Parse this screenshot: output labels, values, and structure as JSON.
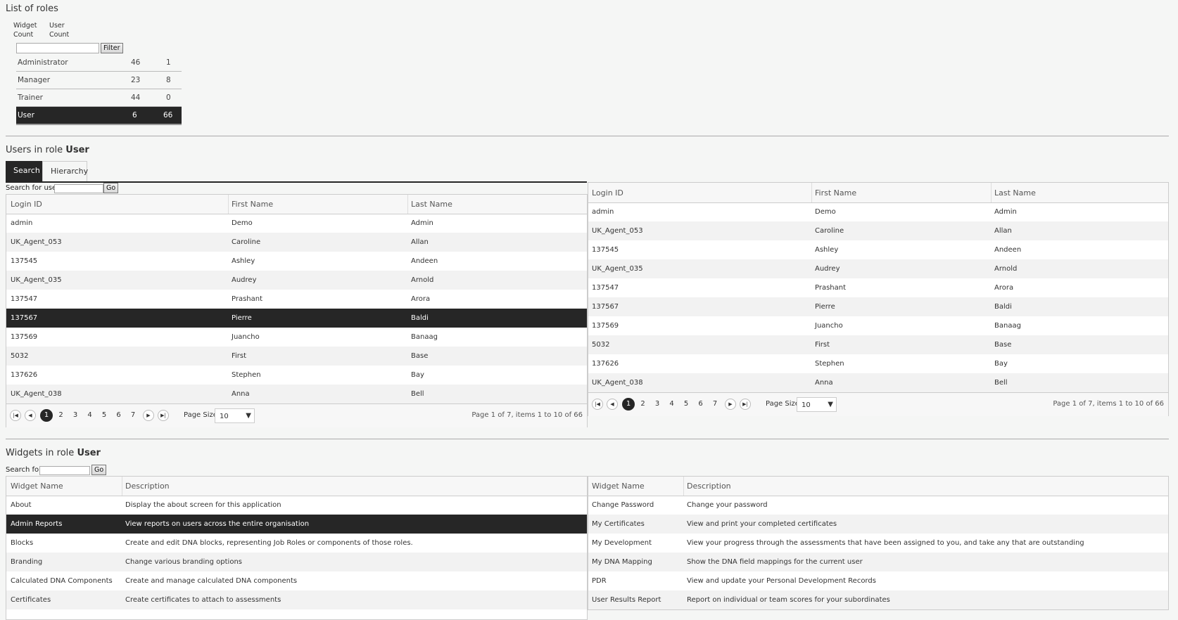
{
  "roles_section": {
    "title": "List of roles",
    "col_widget": [
      "Widget",
      "Count"
    ],
    "col_user": [
      "User",
      "Count"
    ],
    "filter_button": "Filter",
    "filter_value": "",
    "rows": [
      {
        "name": "Administrator",
        "widgets": "46",
        "users": "1"
      },
      {
        "name": "Manager",
        "widgets": "23",
        "users": "8"
      },
      {
        "name": "Trainer",
        "widgets": "44",
        "users": "0"
      },
      {
        "name": "User",
        "widgets": "6",
        "users": "66",
        "selected": true
      }
    ]
  },
  "users_section": {
    "title_prefix": "Users in role ",
    "role": "User",
    "tabs": [
      "Search",
      "Hierarchy"
    ],
    "search_label": "Search for user:",
    "go_button": "Go",
    "columns": [
      "Login ID",
      "First Name",
      "Last Name"
    ],
    "left_rows": [
      [
        "admin",
        "Demo",
        "Admin"
      ],
      [
        "UK_Agent_053",
        "Caroline",
        "Allan"
      ],
      [
        "137545",
        "Ashley",
        "Andeen"
      ],
      [
        "UK_Agent_035",
        "Audrey",
        "Arnold"
      ],
      [
        "137547",
        "Prashant",
        "Arora"
      ],
      [
        "137567",
        "Pierre",
        "Baldi"
      ],
      [
        "137569",
        "Juancho",
        "Banaag"
      ],
      [
        "5032",
        "First",
        "Base"
      ],
      [
        "137626",
        "Stephen",
        "Bay"
      ],
      [
        "UK_Agent_038",
        "Anna",
        "Bell"
      ]
    ],
    "left_selected_index": 5,
    "right_rows": [
      [
        "admin",
        "Demo",
        "Admin"
      ],
      [
        "UK_Agent_053",
        "Caroline",
        "Allan"
      ],
      [
        "137545",
        "Ashley",
        "Andeen"
      ],
      [
        "UK_Agent_035",
        "Audrey",
        "Arnold"
      ],
      [
        "137547",
        "Prashant",
        "Arora"
      ],
      [
        "137567",
        "Pierre",
        "Baldi"
      ],
      [
        "137569",
        "Juancho",
        "Banaag"
      ],
      [
        "5032",
        "First",
        "Base"
      ],
      [
        "137626",
        "Stephen",
        "Bay"
      ],
      [
        "UK_Agent_038",
        "Anna",
        "Bell"
      ]
    ],
    "pager": {
      "pages": [
        "1",
        "2",
        "3",
        "4",
        "5",
        "6",
        "7"
      ],
      "current": "1",
      "page_size_label": "Page Size",
      "page_size": "10",
      "info": "Page 1 of 7, items 1 to 10 of 66"
    }
  },
  "widgets_section": {
    "title_prefix": "Widgets in role ",
    "role": "User",
    "search_label": "Search for:",
    "go_button": "Go",
    "columns": [
      "Widget Name",
      "Description"
    ],
    "left_rows": [
      [
        "About",
        "Display the about screen for this application"
      ],
      [
        "Admin Reports",
        "View reports on users across the entire organisation"
      ],
      [
        "Blocks",
        "Create and edit DNA blocks, representing Job Roles or components of those roles."
      ],
      [
        "Branding",
        "Change various branding options"
      ],
      [
        "Calculated DNA Components",
        "Create and manage calculated DNA components"
      ],
      [
        "Certificates",
        "Create certificates to attach to assessments"
      ]
    ],
    "left_selected_index": 1,
    "right_rows": [
      [
        "Change Password",
        "Change your password"
      ],
      [
        "My Certificates",
        "View and print your completed certificates"
      ],
      [
        "My Development",
        "View your progress through the assessments that have been assigned to you, and take any that are outstanding"
      ],
      [
        "My DNA Mapping",
        "Show the DNA field mappings for the current user"
      ],
      [
        "PDR",
        "View and update your Personal Development Records"
      ],
      [
        "User Results Report",
        "Report on individual or team scores for your subordinates"
      ]
    ]
  }
}
